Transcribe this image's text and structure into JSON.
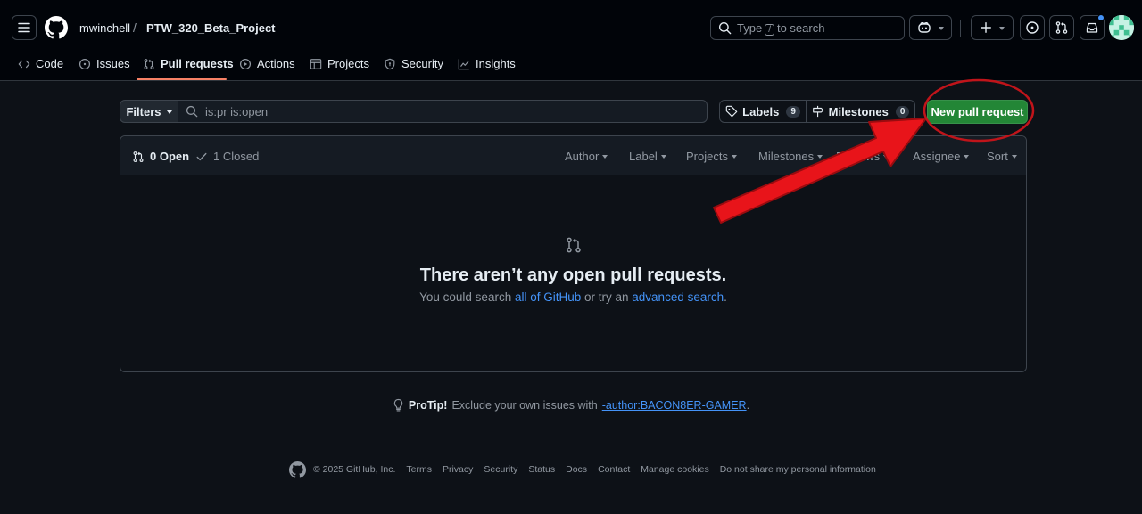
{
  "header": {
    "owner": "mwinchell",
    "separator": "/",
    "repo": "PTW_320_Beta_Project",
    "search": {
      "prefix": "Type",
      "key": "/",
      "suffix": "to search"
    }
  },
  "tabs": [
    {
      "label": "Code",
      "icon": "code-icon"
    },
    {
      "label": "Issues",
      "icon": "issue-opened-icon"
    },
    {
      "label": "Pull requests",
      "icon": "git-pull-request-icon"
    },
    {
      "label": "Actions",
      "icon": "play-icon"
    },
    {
      "label": "Projects",
      "icon": "table-icon"
    },
    {
      "label": "Security",
      "icon": "shield-icon"
    },
    {
      "label": "Insights",
      "icon": "graph-icon"
    }
  ],
  "toolbar": {
    "filters_label": "Filters",
    "filter_query": "is:pr is:open",
    "labels_label": "Labels",
    "labels_count": "9",
    "milestones_label": "Milestones",
    "milestones_count": "0",
    "new_pr_label": "New pull request"
  },
  "list": {
    "open_label": "0 Open",
    "closed_label": "1 Closed",
    "sort_items": [
      "Author",
      "Label",
      "Projects",
      "Milestones",
      "Reviews",
      "Assignee",
      "Sort"
    ]
  },
  "empty_state": {
    "title": "There aren’t any open pull requests.",
    "sub_before": "You could search ",
    "link1": "all of GitHub",
    "sub_middle": " or try an ",
    "link2": "advanced search",
    "sub_after": "."
  },
  "protip": {
    "strong": "ProTip!",
    "text": "Exclude your own issues with",
    "link": "-author:BACON8ER-GAMER",
    "after": "."
  },
  "footer": {
    "copyright": "© 2025 GitHub, Inc.",
    "links": [
      "Terms",
      "Privacy",
      "Security",
      "Status",
      "Docs",
      "Contact",
      "Manage cookies",
      "Do not share my personal information"
    ]
  },
  "colors": {
    "background": "#0d1117",
    "header_bg": "#010409",
    "accent_green": "#238636",
    "link_blue": "#4493f8",
    "annotation_red": "#e8141a"
  }
}
